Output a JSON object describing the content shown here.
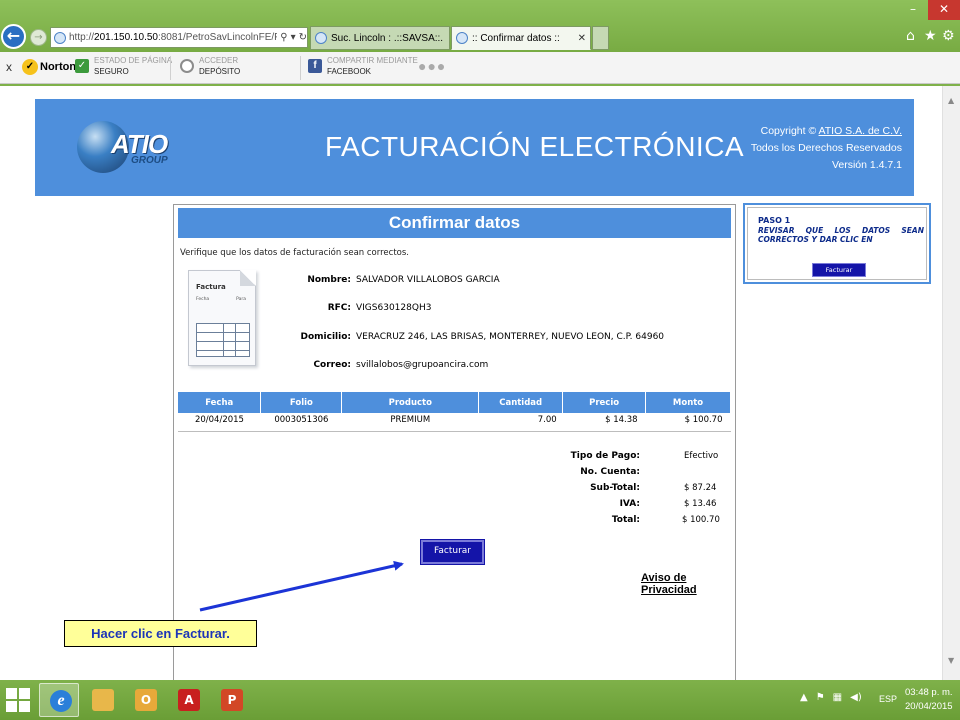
{
  "browser": {
    "address_url_prefix": "http://",
    "address_url_host": "201.150.10.50",
    "address_url_rest": ":8081/PetroSavLincolnFE/FEConfin",
    "search_icon": "magnifier-icon",
    "tabs": [
      {
        "label": "Suc. Lincoln : .::SAVSA::.",
        "active": false
      },
      {
        "label": ":: Confirmar datos ::",
        "active": true
      }
    ]
  },
  "norton": {
    "logo": "Norton",
    "safe_label_1": "ESTADO DE PÁGINA",
    "safe_label_2": "SEGURO",
    "vault_label_1": "ACCEDER",
    "vault_label_2": "DEPÓSITO",
    "fb_label_1": "COMPARTIR MEDIANTE",
    "fb_label_2": "FACEBOOK"
  },
  "banner": {
    "logo_word": "ATIO",
    "logo_sub": "GROUP",
    "title": "FACTURACIÓN ELECTRÓNICA",
    "copyright_prefix": "Copyright © ",
    "copyright_company": "ATIO S.A. de C.V.",
    "rights": "Todos los Derechos Reservados",
    "version": "Versión 1.4.7.1"
  },
  "confirm": {
    "title": "Confirmar datos",
    "verify_text": "Verifique que los datos de facturación sean correctos.",
    "illustration": {
      "title": "Factura",
      "col1": "Fecha",
      "col2": "Para"
    },
    "fields": {
      "nombre_label": "Nombre:",
      "nombre_value": "SALVADOR VILLALOBOS GARCIA",
      "rfc_label": "RFC:",
      "rfc_value": "VIGS630128QH3",
      "domicilio_label": "Domicilio:",
      "domicilio_value": "VERACRUZ 246, LAS BRISAS, MONTERREY, NUEVO LEON, C.P. 64960",
      "correo_label": "Correo:",
      "correo_value": "svillalobos@grupoancira.com"
    },
    "table": {
      "headers": [
        "Fecha",
        "Folio",
        "Producto",
        "Cantidad",
        "Precio",
        "Monto"
      ],
      "rows": [
        [
          "20/04/2015",
          "0003051306",
          "PREMIUM",
          "7.00",
          "$ 14.38",
          "$ 100.70"
        ]
      ]
    },
    "totals": {
      "tipo_pago_label": "Tipo de Pago:",
      "tipo_pago_value": "Efectivo",
      "cuenta_label": "No. Cuenta:",
      "cuenta_value": "",
      "subtotal_label": "Sub-Total:",
      "subtotal_value": "$ 87.24",
      "iva_label": "IVA:",
      "iva_value": "$ 13.46",
      "total_label": "Total:",
      "total_value": "$ 100.70"
    },
    "facturar_label": "Facturar",
    "privacy_label": "Aviso de Privacidad"
  },
  "side": {
    "step_label": "PASO 1",
    "step_text": "REVISAR QUE LOS DATOS SEAN CORRECTOS Y DAR CLIC EN",
    "button_label": "Facturar"
  },
  "callout": {
    "text": "Hacer clic en Facturar."
  },
  "taskbar": {
    "lang": "ESP",
    "time": "03:48 p. m.",
    "date": "20/04/2015"
  },
  "colors": {
    "brand_blue": "#4e8fdc",
    "button_navy": "#1414a8",
    "callout_bg": "#ffff99",
    "callout_text": "#1c34b8",
    "chrome_green": "#7fb14a"
  }
}
